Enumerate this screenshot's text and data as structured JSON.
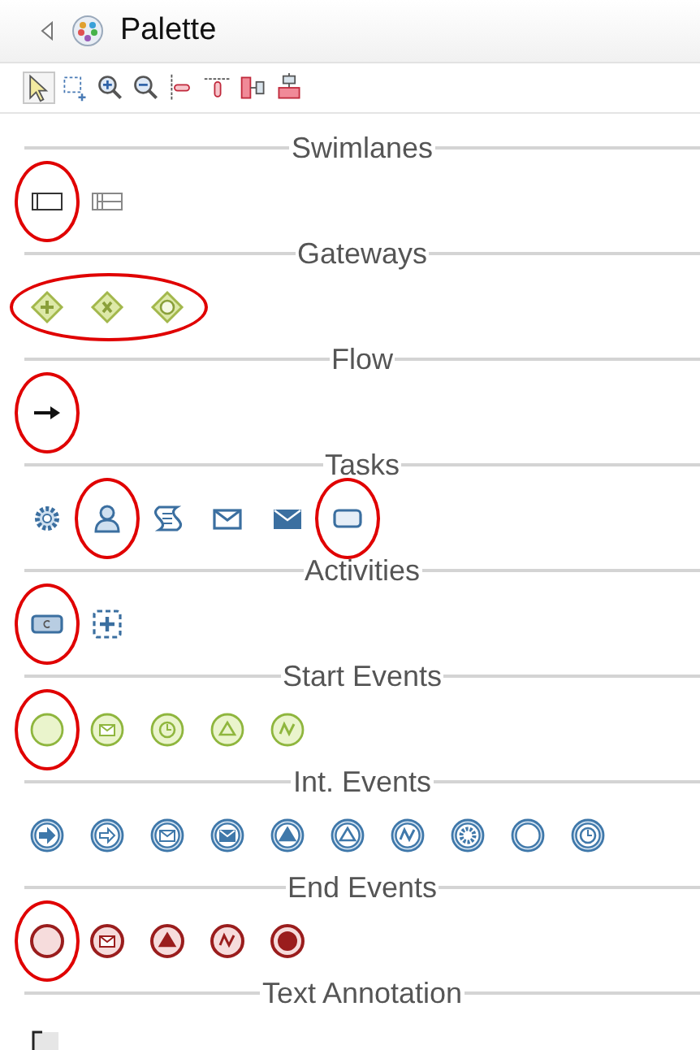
{
  "header": {
    "title": "Palette"
  },
  "toolbar": [
    {
      "kind": "select",
      "selected": true
    },
    {
      "kind": "marquee",
      "selected": false
    },
    {
      "kind": "zoom-in",
      "selected": false
    },
    {
      "kind": "zoom-out",
      "selected": false
    },
    {
      "kind": "align-left",
      "selected": false
    },
    {
      "kind": "align-top",
      "selected": false
    },
    {
      "kind": "match-width",
      "selected": false
    },
    {
      "kind": "match-height",
      "selected": false
    }
  ],
  "sections": [
    {
      "title": "Swimlanes",
      "highlighted": false,
      "items": [
        {
          "kind": "pool",
          "highlighted": true
        },
        {
          "kind": "lane",
          "highlighted": false
        }
      ]
    },
    {
      "title": "Gateways",
      "highlighted": true,
      "items": [
        {
          "kind": "gateway-parallel",
          "highlighted": false
        },
        {
          "kind": "gateway-exclusive",
          "highlighted": false
        },
        {
          "kind": "gateway-event",
          "highlighted": false
        }
      ]
    },
    {
      "title": "Flow",
      "highlighted": false,
      "items": [
        {
          "kind": "sequence-flow",
          "highlighted": true
        }
      ]
    },
    {
      "title": "Tasks",
      "highlighted": false,
      "items": [
        {
          "kind": "service-task",
          "highlighted": false
        },
        {
          "kind": "user-task",
          "highlighted": true
        },
        {
          "kind": "script-task",
          "highlighted": false
        },
        {
          "kind": "receive-task",
          "highlighted": false
        },
        {
          "kind": "send-task",
          "highlighted": false
        },
        {
          "kind": "task",
          "highlighted": true
        }
      ]
    },
    {
      "title": "Activities",
      "highlighted": false,
      "items": [
        {
          "kind": "call-activity",
          "highlighted": true
        },
        {
          "kind": "subprocess",
          "highlighted": false
        }
      ]
    },
    {
      "title": "Start Events",
      "highlighted": false,
      "items": [
        {
          "kind": "start-none",
          "highlighted": true
        },
        {
          "kind": "start-message",
          "highlighted": false
        },
        {
          "kind": "start-timer",
          "highlighted": false
        },
        {
          "kind": "start-triangle",
          "highlighted": false
        },
        {
          "kind": "start-zigzag",
          "highlighted": false
        }
      ]
    },
    {
      "title": "Int. Events",
      "highlighted": false,
      "items": [
        {
          "kind": "intermediate-arrow-filled",
          "highlighted": false
        },
        {
          "kind": "intermediate-arrow",
          "highlighted": false
        },
        {
          "kind": "intermediate-message",
          "highlighted": false
        },
        {
          "kind": "intermediate-message-filled",
          "highlighted": false
        },
        {
          "kind": "intermediate-triangle-filled",
          "highlighted": false
        },
        {
          "kind": "intermediate-triangle",
          "highlighted": false
        },
        {
          "kind": "intermediate-zigzag",
          "highlighted": false
        },
        {
          "kind": "intermediate-cog",
          "highlighted": false
        },
        {
          "kind": "intermediate-none",
          "highlighted": false
        },
        {
          "kind": "intermediate-timer",
          "highlighted": false
        }
      ]
    },
    {
      "title": "End Events",
      "highlighted": false,
      "items": [
        {
          "kind": "end-none",
          "highlighted": true
        },
        {
          "kind": "end-message",
          "highlighted": false
        },
        {
          "kind": "end-triangle-filled",
          "highlighted": false
        },
        {
          "kind": "end-zigzag",
          "highlighted": false
        },
        {
          "kind": "end-stop-filled",
          "highlighted": false
        }
      ]
    },
    {
      "title": "Text Annotation",
      "highlighted": false,
      "items": [
        {
          "kind": "annotation",
          "highlighted": false
        }
      ]
    }
  ]
}
